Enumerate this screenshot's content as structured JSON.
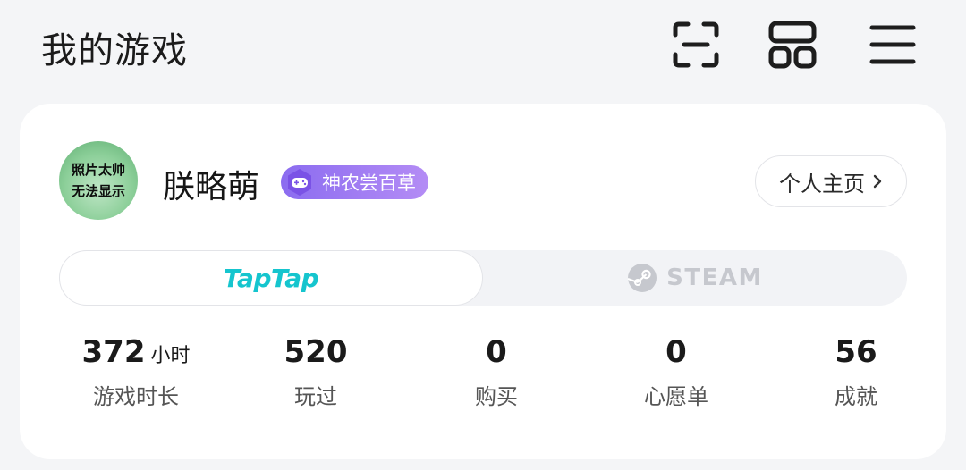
{
  "header": {
    "title": "我的游戏",
    "icons": [
      "scan-icon",
      "layout-grid-icon",
      "menu-icon"
    ]
  },
  "profile": {
    "avatar_text_line1": "照片太帅",
    "avatar_text_line2": "无法显示",
    "username": "朕略萌",
    "badge": {
      "icon": "gamepad-icon",
      "label": "神农尝百草",
      "color": "#9b7af2"
    },
    "home_button": "个人主页"
  },
  "platforms": {
    "selected": "TapTap",
    "tabs": [
      {
        "label": "TapTap",
        "color": "#15c5ce"
      },
      {
        "label": "STEAM",
        "icon": "steam-icon",
        "color": "#c6c8ce"
      }
    ]
  },
  "stats": [
    {
      "value": "372",
      "unit": "小时",
      "label": "游戏时长"
    },
    {
      "value": "520",
      "unit": "",
      "label": "玩过"
    },
    {
      "value": "0",
      "unit": "",
      "label": "购买"
    },
    {
      "value": "0",
      "unit": "",
      "label": "心愿单"
    },
    {
      "value": "56",
      "unit": "",
      "label": "成就"
    }
  ]
}
